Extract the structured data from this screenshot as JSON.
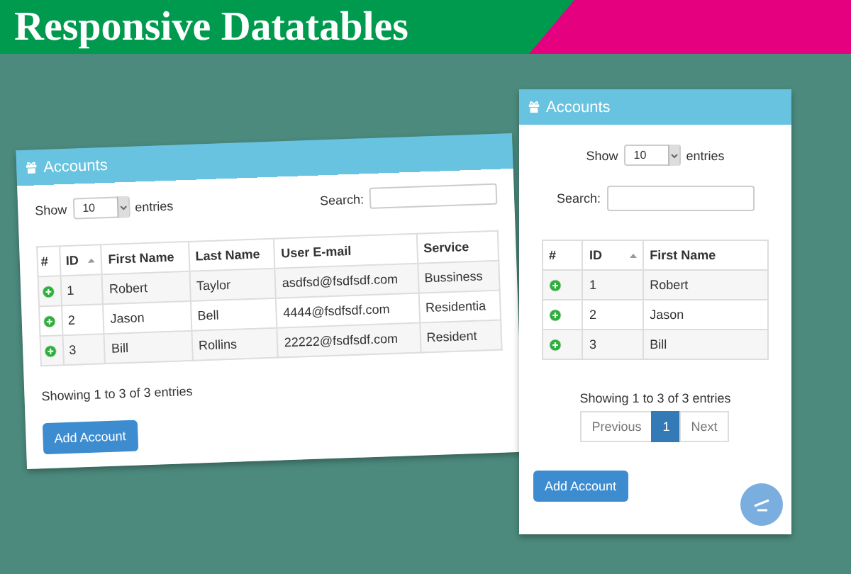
{
  "banner": {
    "title": "Responsive Datatables"
  },
  "panels": [
    {
      "kind": "desktop",
      "title": "Accounts",
      "show_label": "Show",
      "page_length": "10",
      "entries_label": "entries",
      "search_label": "Search:",
      "columns": [
        {
          "label": "#",
          "sorted": false
        },
        {
          "label": "ID",
          "sorted": true
        },
        {
          "label": "First Name",
          "sorted": false
        },
        {
          "label": "Last Name",
          "sorted": false
        },
        {
          "label": "User E-mail",
          "sorted": false
        },
        {
          "label": "Service",
          "sorted": false
        }
      ],
      "rows": [
        {
          "cells": [
            "",
            "1",
            "Robert",
            "Taylor",
            "asdfsd@fsdfsdf.com",
            "Bussiness"
          ]
        },
        {
          "cells": [
            "",
            "2",
            "Jason",
            "Bell",
            "4444@fsdfsdf.com",
            "Residentia"
          ]
        },
        {
          "cells": [
            "",
            "3",
            "Bill",
            "Rollins",
            "22222@fsdfsdf.com",
            "Resident"
          ]
        }
      ],
      "info": "Showing 1 to 3 of 3 entries",
      "add_button": "Add Account"
    },
    {
      "kind": "mobile",
      "title": "Accounts",
      "show_label": "Show",
      "page_length": "10",
      "entries_label": "entries",
      "search_label": "Search:",
      "columns": [
        {
          "label": "#",
          "sorted": false
        },
        {
          "label": "ID",
          "sorted": true
        },
        {
          "label": "First Name",
          "sorted": false
        }
      ],
      "rows": [
        {
          "cells": [
            "",
            "1",
            "Robert"
          ]
        },
        {
          "cells": [
            "",
            "2",
            "Jason"
          ]
        },
        {
          "cells": [
            "",
            "3",
            "Bill"
          ]
        }
      ],
      "info": "Showing 1 to 3 of 3 entries",
      "pagination": [
        {
          "label": "Previous",
          "selected": false
        },
        {
          "label": "1",
          "selected": true
        },
        {
          "label": "Next",
          "selected": false
        }
      ],
      "add_button": "Add Account"
    }
  ]
}
